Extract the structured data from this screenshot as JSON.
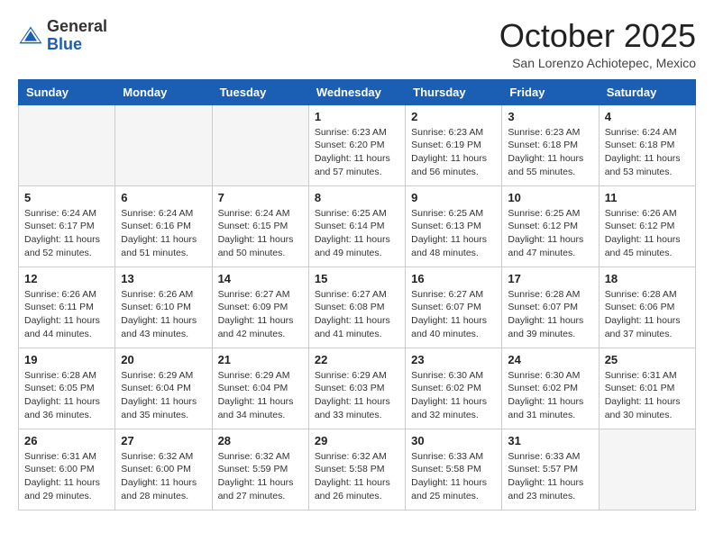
{
  "header": {
    "logo_general": "General",
    "logo_blue": "Blue",
    "month_title": "October 2025",
    "location": "San Lorenzo Achiotepec, Mexico"
  },
  "days_of_week": [
    "Sunday",
    "Monday",
    "Tuesday",
    "Wednesday",
    "Thursday",
    "Friday",
    "Saturday"
  ],
  "weeks": [
    [
      {
        "day": "",
        "empty": true
      },
      {
        "day": "",
        "empty": true
      },
      {
        "day": "",
        "empty": true
      },
      {
        "day": "1",
        "sunrise": "6:23 AM",
        "sunset": "6:20 PM",
        "daylight": "11 hours and 57 minutes."
      },
      {
        "day": "2",
        "sunrise": "6:23 AM",
        "sunset": "6:19 PM",
        "daylight": "11 hours and 56 minutes."
      },
      {
        "day": "3",
        "sunrise": "6:23 AM",
        "sunset": "6:18 PM",
        "daylight": "11 hours and 55 minutes."
      },
      {
        "day": "4",
        "sunrise": "6:24 AM",
        "sunset": "6:18 PM",
        "daylight": "11 hours and 53 minutes."
      }
    ],
    [
      {
        "day": "5",
        "sunrise": "6:24 AM",
        "sunset": "6:17 PM",
        "daylight": "11 hours and 52 minutes."
      },
      {
        "day": "6",
        "sunrise": "6:24 AM",
        "sunset": "6:16 PM",
        "daylight": "11 hours and 51 minutes."
      },
      {
        "day": "7",
        "sunrise": "6:24 AM",
        "sunset": "6:15 PM",
        "daylight": "11 hours and 50 minutes."
      },
      {
        "day": "8",
        "sunrise": "6:25 AM",
        "sunset": "6:14 PM",
        "daylight": "11 hours and 49 minutes."
      },
      {
        "day": "9",
        "sunrise": "6:25 AM",
        "sunset": "6:13 PM",
        "daylight": "11 hours and 48 minutes."
      },
      {
        "day": "10",
        "sunrise": "6:25 AM",
        "sunset": "6:12 PM",
        "daylight": "11 hours and 47 minutes."
      },
      {
        "day": "11",
        "sunrise": "6:26 AM",
        "sunset": "6:12 PM",
        "daylight": "11 hours and 45 minutes."
      }
    ],
    [
      {
        "day": "12",
        "sunrise": "6:26 AM",
        "sunset": "6:11 PM",
        "daylight": "11 hours and 44 minutes."
      },
      {
        "day": "13",
        "sunrise": "6:26 AM",
        "sunset": "6:10 PM",
        "daylight": "11 hours and 43 minutes."
      },
      {
        "day": "14",
        "sunrise": "6:27 AM",
        "sunset": "6:09 PM",
        "daylight": "11 hours and 42 minutes."
      },
      {
        "day": "15",
        "sunrise": "6:27 AM",
        "sunset": "6:08 PM",
        "daylight": "11 hours and 41 minutes."
      },
      {
        "day": "16",
        "sunrise": "6:27 AM",
        "sunset": "6:07 PM",
        "daylight": "11 hours and 40 minutes."
      },
      {
        "day": "17",
        "sunrise": "6:28 AM",
        "sunset": "6:07 PM",
        "daylight": "11 hours and 39 minutes."
      },
      {
        "day": "18",
        "sunrise": "6:28 AM",
        "sunset": "6:06 PM",
        "daylight": "11 hours and 37 minutes."
      }
    ],
    [
      {
        "day": "19",
        "sunrise": "6:28 AM",
        "sunset": "6:05 PM",
        "daylight": "11 hours and 36 minutes."
      },
      {
        "day": "20",
        "sunrise": "6:29 AM",
        "sunset": "6:04 PM",
        "daylight": "11 hours and 35 minutes."
      },
      {
        "day": "21",
        "sunrise": "6:29 AM",
        "sunset": "6:04 PM",
        "daylight": "11 hours and 34 minutes."
      },
      {
        "day": "22",
        "sunrise": "6:29 AM",
        "sunset": "6:03 PM",
        "daylight": "11 hours and 33 minutes."
      },
      {
        "day": "23",
        "sunrise": "6:30 AM",
        "sunset": "6:02 PM",
        "daylight": "11 hours and 32 minutes."
      },
      {
        "day": "24",
        "sunrise": "6:30 AM",
        "sunset": "6:02 PM",
        "daylight": "11 hours and 31 minutes."
      },
      {
        "day": "25",
        "sunrise": "6:31 AM",
        "sunset": "6:01 PM",
        "daylight": "11 hours and 30 minutes."
      }
    ],
    [
      {
        "day": "26",
        "sunrise": "6:31 AM",
        "sunset": "6:00 PM",
        "daylight": "11 hours and 29 minutes."
      },
      {
        "day": "27",
        "sunrise": "6:32 AM",
        "sunset": "6:00 PM",
        "daylight": "11 hours and 28 minutes."
      },
      {
        "day": "28",
        "sunrise": "6:32 AM",
        "sunset": "5:59 PM",
        "daylight": "11 hours and 27 minutes."
      },
      {
        "day": "29",
        "sunrise": "6:32 AM",
        "sunset": "5:58 PM",
        "daylight": "11 hours and 26 minutes."
      },
      {
        "day": "30",
        "sunrise": "6:33 AM",
        "sunset": "5:58 PM",
        "daylight": "11 hours and 25 minutes."
      },
      {
        "day": "31",
        "sunrise": "6:33 AM",
        "sunset": "5:57 PM",
        "daylight": "11 hours and 23 minutes."
      },
      {
        "day": "",
        "empty": true
      }
    ]
  ],
  "labels": {
    "sunrise": "Sunrise:",
    "sunset": "Sunset:",
    "daylight": "Daylight:"
  }
}
